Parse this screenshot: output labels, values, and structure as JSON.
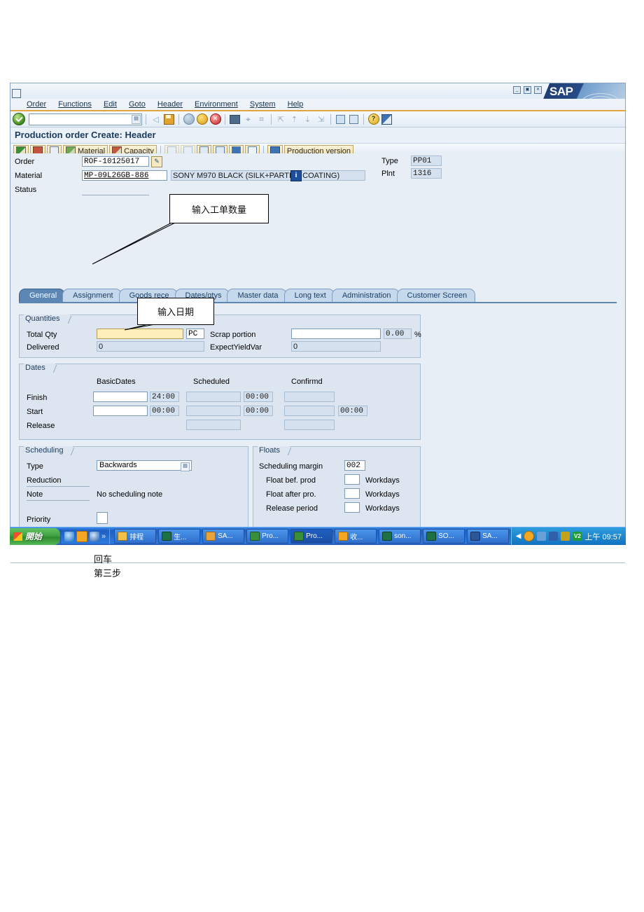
{
  "window": {
    "menu": [
      {
        "label": "Order",
        "accel": "O"
      },
      {
        "label": "Functions",
        "accel": "n"
      },
      {
        "label": "Edit",
        "accel": "E"
      },
      {
        "label": "Goto",
        "accel": "G"
      },
      {
        "label": "Header",
        "accel": "a"
      },
      {
        "label": "Environment",
        "accel": "E"
      },
      {
        "label": "System",
        "accel": "y"
      },
      {
        "label": "Help",
        "accel": "H"
      }
    ],
    "brand": "SAP",
    "title": "Production order Create: Header",
    "command_value": "",
    "window_controls": [
      "minimize",
      "maximize",
      "close"
    ]
  },
  "app_toolbar": {
    "buttons": [
      {
        "name": "components-flag",
        "label": ""
      },
      {
        "name": "operation-overview",
        "label": ""
      },
      {
        "name": "calculator",
        "label": ""
      },
      {
        "name": "material-button",
        "label": "Material"
      },
      {
        "name": "capacity-button",
        "label": "Capacity"
      },
      {
        "name": "sequences",
        "label": ""
      },
      {
        "name": "documents",
        "label": ""
      },
      {
        "name": "components-tree",
        "label": ""
      },
      {
        "name": "operation-tree",
        "label": ""
      },
      {
        "name": "copy-ref",
        "label": ""
      },
      {
        "name": "list-button",
        "label": ""
      },
      {
        "name": "grid-button",
        "label": ""
      },
      {
        "name": "production-version-button",
        "label": "Production version"
      }
    ]
  },
  "header": {
    "order_label": "Order",
    "order_value": "ROF-10125017",
    "material_label": "Material",
    "material_value": "MP-09L26GB-886",
    "material_desc": "SONY M970 BLACK (SILK+PARTIAL COATING)",
    "status_label": "Status",
    "status_value": "",
    "type_label": "Type",
    "type_value": "PP01",
    "plant_label": "Plnt",
    "plant_value": "1316"
  },
  "tabs": [
    {
      "label": "General",
      "active": true
    },
    {
      "label": "Assignment",
      "active": false
    },
    {
      "label": "Goods rece",
      "active": false
    },
    {
      "label": "Dates/qtys",
      "active": false
    },
    {
      "label": "Master data",
      "active": false
    },
    {
      "label": "Long text",
      "active": false
    },
    {
      "label": "Administration",
      "active": false
    },
    {
      "label": "Customer Screen",
      "active": false
    }
  ],
  "quantities": {
    "group_label": "Quantities",
    "total_qty_label": "Total Qty",
    "total_qty_value": "",
    "uom": "PC",
    "scrap_label": "Scrap portion",
    "scrap_value": "",
    "scrap_pct": "0.00",
    "percent_sign": "%",
    "delivered_label": "Delivered",
    "delivered_value": "0",
    "expect_yield_label": "ExpectYieldVar",
    "expect_yield_value": "0"
  },
  "dates": {
    "group_label": "Dates",
    "col_basic": "BasicDates",
    "col_scheduled": "Scheduled",
    "col_confirmd": "Confirmd",
    "rows": [
      {
        "label": "Finish",
        "basic": "",
        "basic_time": "24:00",
        "sched": "",
        "sched_time": "00:00",
        "conf": "",
        "conf_time": ""
      },
      {
        "label": "Start",
        "basic": "",
        "basic_time": "00:00",
        "sched": "",
        "sched_time": "00:00",
        "conf": "",
        "conf_time": "00:00"
      },
      {
        "label": "Release",
        "basic": "",
        "basic_time": "",
        "sched": "",
        "sched_time": "",
        "conf": "",
        "conf_time": ""
      }
    ]
  },
  "scheduling": {
    "group_label": "Scheduling",
    "type_label": "Type",
    "type_value": "Backwards",
    "reduction_label": "Reduction",
    "reduction_value": "",
    "note_label": "Note",
    "note_value": "No scheduling note",
    "priority_label": "Priority",
    "priority_value": ""
  },
  "floats": {
    "group_label": "Floats",
    "margin_label": "Scheduling margin",
    "margin_value": "002",
    "before_label": "Float bef. prod",
    "before_value": "",
    "after_label": "Float after pro.",
    "after_value": "",
    "release_label": "Release period",
    "release_value": "",
    "unit": "Workdays"
  },
  "callouts": [
    {
      "name": "qty-callout",
      "text": "输入工单数量"
    },
    {
      "name": "date-callout",
      "text": "输入日期"
    }
  ],
  "notes": [
    {
      "text": "回车"
    },
    {
      "text": "第三步"
    }
  ],
  "taskbar": {
    "start_label": "開始",
    "quicklaunch": [
      "ie-icon",
      "media-icon",
      "explorer-icon",
      "chevron-more-icon"
    ],
    "items": [
      {
        "icon": "folder-icon",
        "label": "排程"
      },
      {
        "icon": "excel-icon",
        "label": "生..."
      },
      {
        "icon": "sap-logon-icon",
        "label": "SA..."
      },
      {
        "icon": "note-icon",
        "label": "Pro..."
      },
      {
        "icon": "note-icon",
        "label": "Pro..."
      },
      {
        "icon": "media-icon",
        "label": "收..."
      },
      {
        "icon": "excel-icon",
        "label": "son..."
      },
      {
        "icon": "excel-icon",
        "label": "SO..."
      },
      {
        "icon": "word-icon",
        "label": "SA..."
      }
    ],
    "tray_icons": [
      "chevron-left-icon",
      "clock-icon",
      "network-icon",
      "connection-icon",
      "shield-icon",
      "v2-icon"
    ],
    "clock": "上午 09:57"
  },
  "colors": {
    "accent": "#5c86b4",
    "window_bg": "#e8eef5",
    "group_bg": "#dde6f0",
    "readonly_bg": "#d5e1ee",
    "highlight_yellow": "#fdeeba",
    "menu_underline": "#e3a33d",
    "taskbar_blue": "#2b73d6",
    "start_green": "#3fa23f"
  }
}
